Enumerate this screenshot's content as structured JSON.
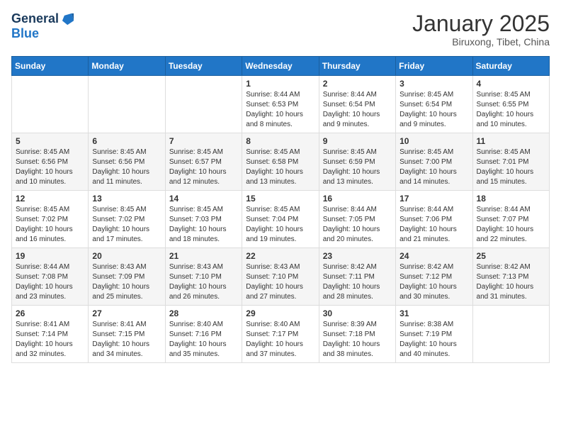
{
  "header": {
    "logo_line1": "General",
    "logo_line2": "Blue",
    "month": "January 2025",
    "location": "Biruxong, Tibet, China"
  },
  "weekdays": [
    "Sunday",
    "Monday",
    "Tuesday",
    "Wednesday",
    "Thursday",
    "Friday",
    "Saturday"
  ],
  "weeks": [
    [
      {
        "day": "",
        "info": ""
      },
      {
        "day": "",
        "info": ""
      },
      {
        "day": "",
        "info": ""
      },
      {
        "day": "1",
        "info": "Sunrise: 8:44 AM\nSunset: 6:53 PM\nDaylight: 10 hours\nand 8 minutes."
      },
      {
        "day": "2",
        "info": "Sunrise: 8:44 AM\nSunset: 6:54 PM\nDaylight: 10 hours\nand 9 minutes."
      },
      {
        "day": "3",
        "info": "Sunrise: 8:45 AM\nSunset: 6:54 PM\nDaylight: 10 hours\nand 9 minutes."
      },
      {
        "day": "4",
        "info": "Sunrise: 8:45 AM\nSunset: 6:55 PM\nDaylight: 10 hours\nand 10 minutes."
      }
    ],
    [
      {
        "day": "5",
        "info": "Sunrise: 8:45 AM\nSunset: 6:56 PM\nDaylight: 10 hours\nand 10 minutes."
      },
      {
        "day": "6",
        "info": "Sunrise: 8:45 AM\nSunset: 6:56 PM\nDaylight: 10 hours\nand 11 minutes."
      },
      {
        "day": "7",
        "info": "Sunrise: 8:45 AM\nSunset: 6:57 PM\nDaylight: 10 hours\nand 12 minutes."
      },
      {
        "day": "8",
        "info": "Sunrise: 8:45 AM\nSunset: 6:58 PM\nDaylight: 10 hours\nand 13 minutes."
      },
      {
        "day": "9",
        "info": "Sunrise: 8:45 AM\nSunset: 6:59 PM\nDaylight: 10 hours\nand 13 minutes."
      },
      {
        "day": "10",
        "info": "Sunrise: 8:45 AM\nSunset: 7:00 PM\nDaylight: 10 hours\nand 14 minutes."
      },
      {
        "day": "11",
        "info": "Sunrise: 8:45 AM\nSunset: 7:01 PM\nDaylight: 10 hours\nand 15 minutes."
      }
    ],
    [
      {
        "day": "12",
        "info": "Sunrise: 8:45 AM\nSunset: 7:02 PM\nDaylight: 10 hours\nand 16 minutes."
      },
      {
        "day": "13",
        "info": "Sunrise: 8:45 AM\nSunset: 7:02 PM\nDaylight: 10 hours\nand 17 minutes."
      },
      {
        "day": "14",
        "info": "Sunrise: 8:45 AM\nSunset: 7:03 PM\nDaylight: 10 hours\nand 18 minutes."
      },
      {
        "day": "15",
        "info": "Sunrise: 8:45 AM\nSunset: 7:04 PM\nDaylight: 10 hours\nand 19 minutes."
      },
      {
        "day": "16",
        "info": "Sunrise: 8:44 AM\nSunset: 7:05 PM\nDaylight: 10 hours\nand 20 minutes."
      },
      {
        "day": "17",
        "info": "Sunrise: 8:44 AM\nSunset: 7:06 PM\nDaylight: 10 hours\nand 21 minutes."
      },
      {
        "day": "18",
        "info": "Sunrise: 8:44 AM\nSunset: 7:07 PM\nDaylight: 10 hours\nand 22 minutes."
      }
    ],
    [
      {
        "day": "19",
        "info": "Sunrise: 8:44 AM\nSunset: 7:08 PM\nDaylight: 10 hours\nand 23 minutes."
      },
      {
        "day": "20",
        "info": "Sunrise: 8:43 AM\nSunset: 7:09 PM\nDaylight: 10 hours\nand 25 minutes."
      },
      {
        "day": "21",
        "info": "Sunrise: 8:43 AM\nSunset: 7:10 PM\nDaylight: 10 hours\nand 26 minutes."
      },
      {
        "day": "22",
        "info": "Sunrise: 8:43 AM\nSunset: 7:10 PM\nDaylight: 10 hours\nand 27 minutes."
      },
      {
        "day": "23",
        "info": "Sunrise: 8:42 AM\nSunset: 7:11 PM\nDaylight: 10 hours\nand 28 minutes."
      },
      {
        "day": "24",
        "info": "Sunrise: 8:42 AM\nSunset: 7:12 PM\nDaylight: 10 hours\nand 30 minutes."
      },
      {
        "day": "25",
        "info": "Sunrise: 8:42 AM\nSunset: 7:13 PM\nDaylight: 10 hours\nand 31 minutes."
      }
    ],
    [
      {
        "day": "26",
        "info": "Sunrise: 8:41 AM\nSunset: 7:14 PM\nDaylight: 10 hours\nand 32 minutes."
      },
      {
        "day": "27",
        "info": "Sunrise: 8:41 AM\nSunset: 7:15 PM\nDaylight: 10 hours\nand 34 minutes."
      },
      {
        "day": "28",
        "info": "Sunrise: 8:40 AM\nSunset: 7:16 PM\nDaylight: 10 hours\nand 35 minutes."
      },
      {
        "day": "29",
        "info": "Sunrise: 8:40 AM\nSunset: 7:17 PM\nDaylight: 10 hours\nand 37 minutes."
      },
      {
        "day": "30",
        "info": "Sunrise: 8:39 AM\nSunset: 7:18 PM\nDaylight: 10 hours\nand 38 minutes."
      },
      {
        "day": "31",
        "info": "Sunrise: 8:38 AM\nSunset: 7:19 PM\nDaylight: 10 hours\nand 40 minutes."
      },
      {
        "day": "",
        "info": ""
      }
    ]
  ]
}
